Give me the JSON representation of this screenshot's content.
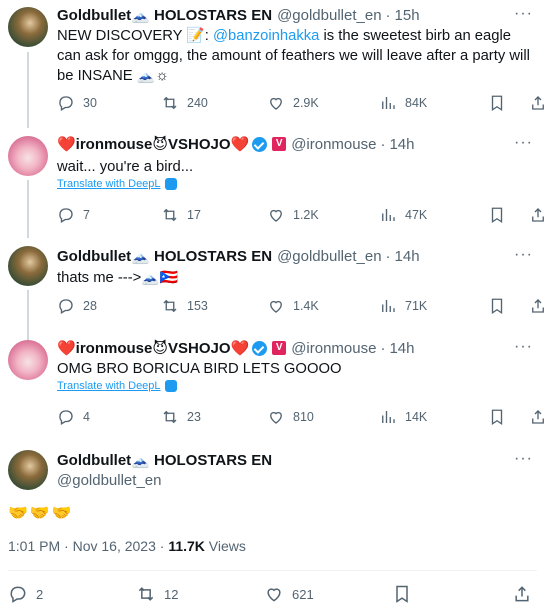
{
  "tweets": [
    {
      "name": "Goldbullet🗻 HOLOSTARS EN",
      "handle": "@goldbullet_en",
      "time": "15h",
      "text_pre": "NEW DISCOVERY 📝: ",
      "mention": "@banzoinhakka",
      "text_post": " is the sweetest birb an eagle can ask for omggg, the amount of feathers we will leave after a party will be INSANE 🗻☼",
      "replies": "30",
      "reposts": "240",
      "likes": "2.9K",
      "views": "84K"
    },
    {
      "name": "❤️ironmouse😈VSHOJO❤️",
      "handle": "@ironmouse",
      "time": "14h",
      "text": "wait... you're a bird...",
      "translate": "Translate with DeepL",
      "replies": "7",
      "reposts": "17",
      "likes": "1.2K",
      "views": "47K"
    },
    {
      "name": "Goldbullet🗻 HOLOSTARS EN",
      "handle": "@goldbullet_en",
      "time": "14h",
      "text": "thats me --->🗻🇵🇷",
      "replies": "28",
      "reposts": "153",
      "likes": "1.4K",
      "views": "71K"
    },
    {
      "name": "❤️ironmouse😈VSHOJO❤️",
      "handle": "@ironmouse",
      "time": "14h",
      "text": "OMG BRO BORICUA BIRD LETS GOOOO",
      "translate": "Translate with DeepL",
      "replies": "4",
      "reposts": "23",
      "likes": "810",
      "views": "14K"
    }
  ],
  "main_tweet": {
    "name": "Goldbullet🗻 HOLOSTARS EN",
    "handle": "@goldbullet_en",
    "text": "🤝🤝🤝",
    "timestamp": "1:01 PM · Nov 16, 2023 · ",
    "views_count": "11.7K",
    "views_label": " Views",
    "replies": "2",
    "reposts": "12",
    "likes": "621"
  },
  "more_label": "···",
  "separator": "·",
  "verified_letter": "V"
}
